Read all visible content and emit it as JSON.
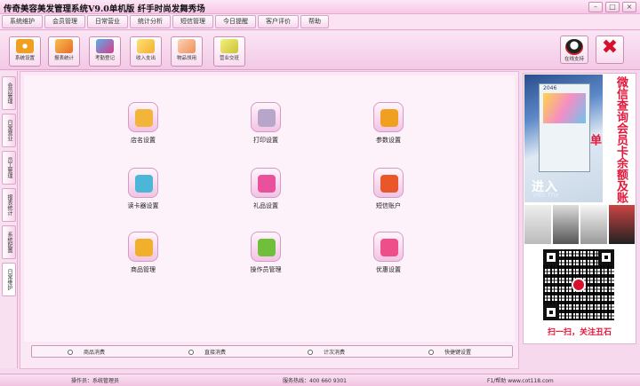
{
  "window": {
    "title": "传奇美容美发管理系统V9.0单机版  纤手时尚发舞秀场"
  },
  "menu": [
    "系统维护",
    "会员管理",
    "日常营业",
    "统计分析",
    "短信管理",
    "今日提醒",
    "客户评价",
    "帮助"
  ],
  "toolbar": {
    "buttons": [
      {
        "label": "系统设置",
        "icon": "gear-icon",
        "color": "#f0a020"
      },
      {
        "label": "报表统计",
        "icon": "chart-icon",
        "color": "#e86b2a"
      },
      {
        "label": "考勤登记",
        "icon": "clock-icon",
        "color": "#d73a8a"
      },
      {
        "label": "收入支出",
        "icon": "wallet-icon",
        "color": "#f3b02c"
      },
      {
        "label": "物品领用",
        "icon": "hand-icon",
        "color": "#ef8f5a"
      },
      {
        "label": "营业交班",
        "icon": "handover-icon",
        "color": "#c9c23a"
      }
    ],
    "online_support": {
      "label": "在线支持",
      "icon": "qq-icon",
      "color": "#c8232c"
    },
    "exit": {
      "icon": "close-icon",
      "color": "#d9102c"
    }
  },
  "left_tabs": [
    "会员管理",
    "日常营业",
    "员工管理",
    "报表统计",
    "系统配置",
    "日常维护"
  ],
  "grid": [
    {
      "label": "店名设置",
      "icon": "store-icon",
      "color": "#f2b43a"
    },
    {
      "label": "打印设置",
      "icon": "printer-icon",
      "color": "#b7a6c9"
    },
    {
      "label": "参数设置",
      "icon": "puzzle-icon",
      "color": "#f0a020"
    },
    {
      "label": "读卡器设置",
      "icon": "card-reader-icon",
      "color": "#4cb6d8"
    },
    {
      "label": "礼品设置",
      "icon": "gift-icon",
      "color": "#e9519c"
    },
    {
      "label": "短信账户",
      "icon": "sms-icon",
      "color": "#e8562a"
    },
    {
      "label": "商品管理",
      "icon": "goods-icon",
      "color": "#f0b02c"
    },
    {
      "label": "操作员管理",
      "icon": "users-icon",
      "color": "#6fbf3a"
    },
    {
      "label": "优惠设置",
      "icon": "discount-icon",
      "color": "#ee4f8b"
    }
  ],
  "radios": [
    "商品消费",
    "直接消费",
    "计次消费",
    "快捷键设置"
  ],
  "ad": {
    "headline": "微信查询会员卡余额及账单",
    "screenshot_text": "进入",
    "screenshot_subtext": "Into The",
    "screen_number": "2046",
    "scan_text": "扫一扫，关注丑石"
  },
  "status": {
    "operator": "操作员：系统管理员",
    "hotline": "服务热线：400 660 9301",
    "help": "F1/帮助 www.cot118.com"
  }
}
